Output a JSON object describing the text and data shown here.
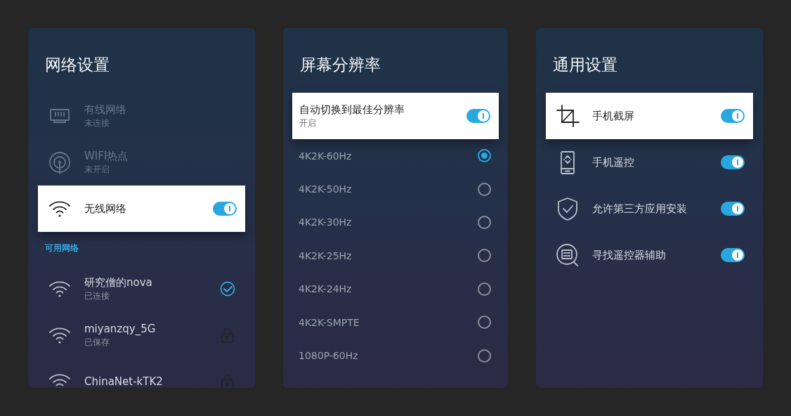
{
  "panels": [
    {
      "title": "网络设置",
      "items": [
        {
          "kind": "setting",
          "label": "有线网络",
          "sublabel": "未连接",
          "disabled": true,
          "focused": false
        },
        {
          "kind": "setting",
          "label": "WIFI热点",
          "sublabel": "未开启",
          "disabled": true,
          "focused": false
        },
        {
          "kind": "switch",
          "label": "无线网络",
          "on": true,
          "focused": true
        },
        {
          "kind": "header",
          "label": "可用网络"
        },
        {
          "kind": "network",
          "label": "研究僧的nova",
          "sublabel": "已连接",
          "connected": true,
          "focused": false
        },
        {
          "kind": "network",
          "label": "miyanzqy_5G",
          "sublabel": "已保存",
          "connected": false,
          "focused": false
        },
        {
          "kind": "network",
          "label": "ChinaNet-kTK2",
          "connected": false,
          "focused": false
        }
      ]
    },
    {
      "title": "屏幕分辨率",
      "items": [
        {
          "kind": "switch",
          "label": "自动切换到最佳分辨率",
          "sublabel": "开启",
          "on": true,
          "focused": true
        },
        {
          "kind": "radio",
          "label": "4K2K-60Hz",
          "selected": true,
          "focused": false
        },
        {
          "kind": "radio",
          "label": "4K2K-50Hz",
          "selected": false,
          "focused": false
        },
        {
          "kind": "radio",
          "label": "4K2K-30Hz",
          "selected": false,
          "focused": false
        },
        {
          "kind": "radio",
          "label": "4K2K-25Hz",
          "selected": false,
          "focused": false
        },
        {
          "kind": "radio",
          "label": "4K2K-24Hz",
          "selected": false,
          "focused": false
        },
        {
          "kind": "radio",
          "label": "4K2K-SMPTE",
          "selected": false,
          "focused": false
        },
        {
          "kind": "radio",
          "label": "1080P-60Hz",
          "selected": false,
          "focused": false
        }
      ]
    },
    {
      "title": "通用设置",
      "items": [
        {
          "kind": "switch",
          "label": "手机截屏",
          "on": true,
          "focused": true
        },
        {
          "kind": "switch",
          "label": "手机遥控",
          "on": true,
          "focused": false
        },
        {
          "kind": "switch",
          "label": "允许第三方应用安装",
          "on": true,
          "focused": false
        },
        {
          "kind": "switch",
          "label": "寻找遥控器辅助",
          "on": true,
          "focused": false
        }
      ]
    }
  ]
}
